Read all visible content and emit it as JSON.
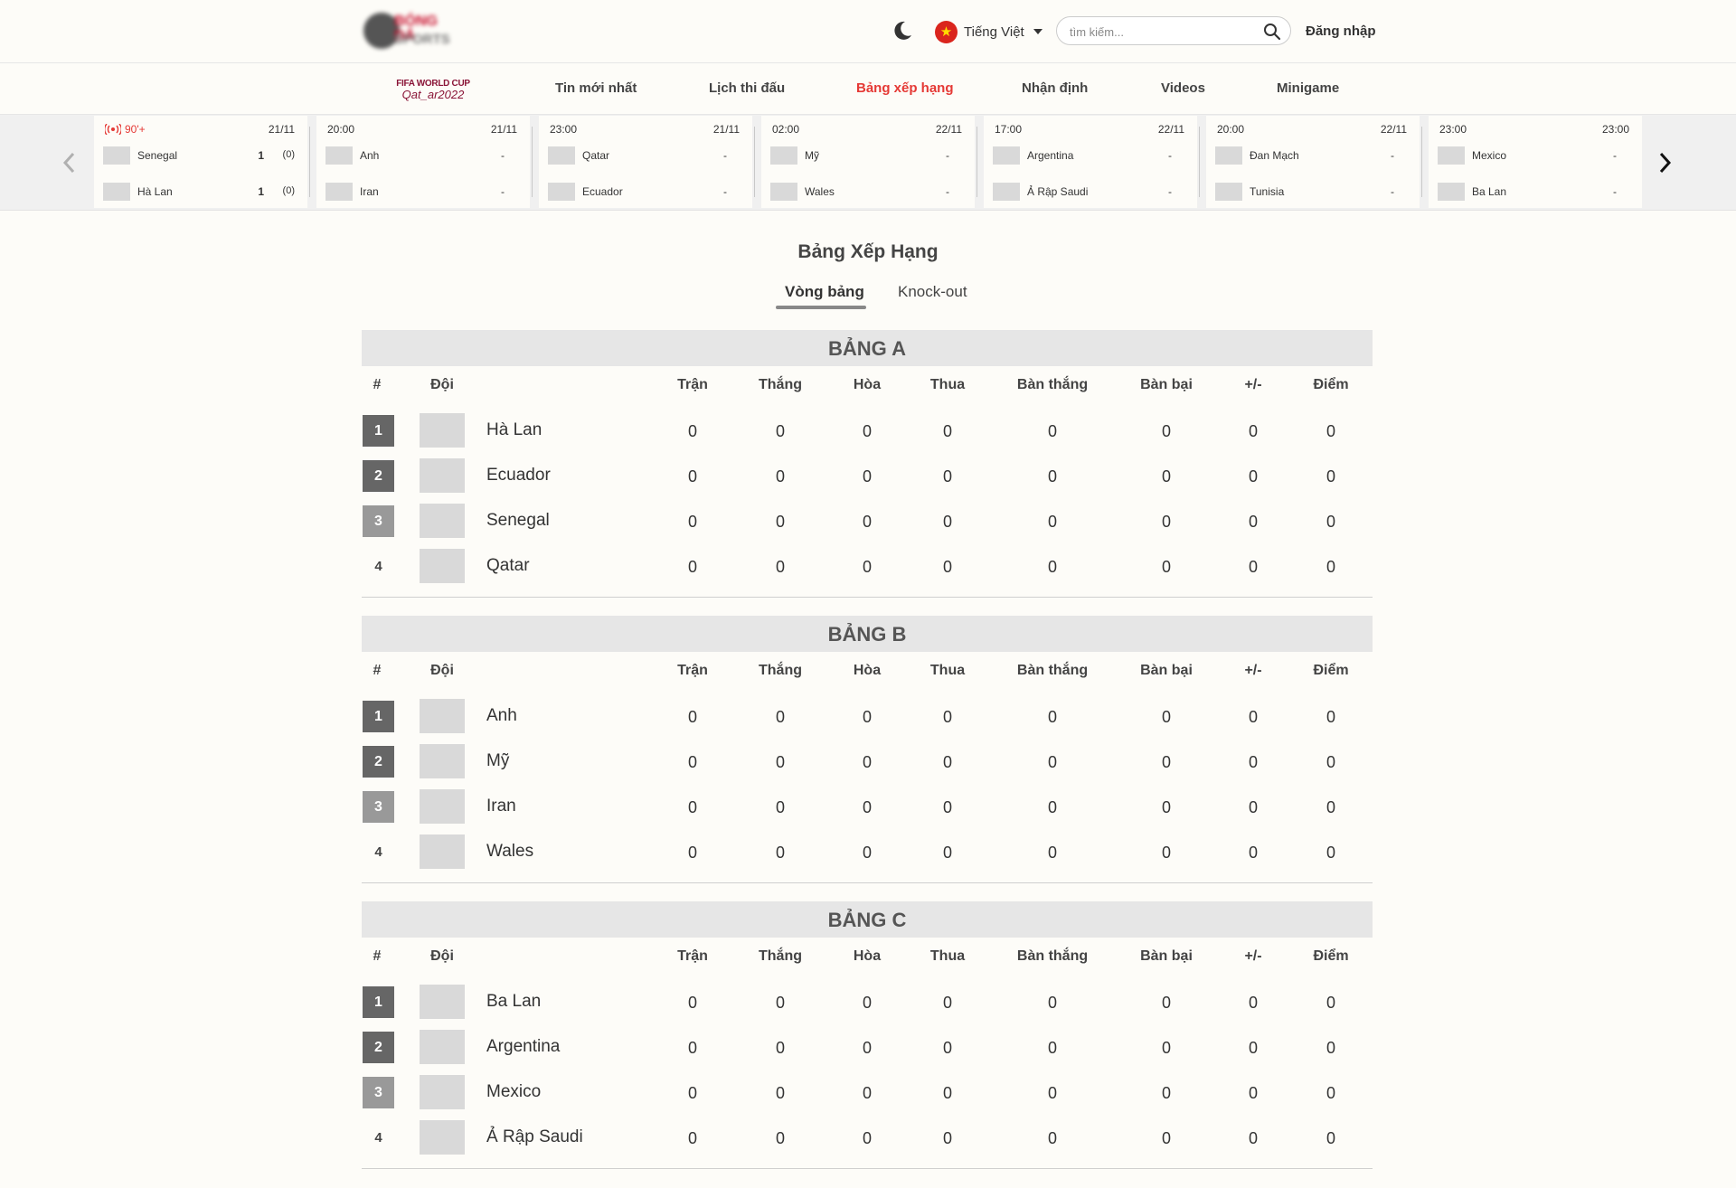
{
  "header": {
    "logo_line1": "BÓNG ĐÁ",
    "logo_line2": "SPORTS",
    "language": "Tiếng Việt",
    "search_placeholder": "tìm kiếm...",
    "login": "Đăng nhập"
  },
  "nav": {
    "wc_logo_line1": "FIFA WORLD CUP",
    "wc_logo_line2": "Qat_ar2022",
    "items": [
      "Tin mới nhất",
      "Lịch thi đấu",
      "Bảng xếp hạng",
      "Nhận định",
      "Videos",
      "Minigame"
    ],
    "active": "Bảng xếp hạng"
  },
  "matches": [
    {
      "time": "90'+",
      "live": true,
      "date": "21/11",
      "home": "Senegal",
      "away": "Hà Lan",
      "home_score": "1",
      "away_score": "1",
      "home_pen": "(0)",
      "away_pen": "(0)"
    },
    {
      "time": "20:00",
      "date": "21/11",
      "home": "Anh",
      "away": "Iran",
      "home_score": "-",
      "away_score": "-"
    },
    {
      "time": "23:00",
      "date": "21/11",
      "home": "Qatar",
      "away": "Ecuador",
      "home_score": "-",
      "away_score": "-"
    },
    {
      "time": "02:00",
      "date": "22/11",
      "home": "Mỹ",
      "away": "Wales",
      "home_score": "-",
      "away_score": "-"
    },
    {
      "time": "17:00",
      "date": "22/11",
      "home": "Argentina",
      "away": "Ả Rập Saudi",
      "home_score": "-",
      "away_score": "-"
    },
    {
      "time": "20:00",
      "date": "22/11",
      "home": "Đan Mạch",
      "away": "Tunisia",
      "home_score": "-",
      "away_score": "-"
    },
    {
      "time": "23:00",
      "date": "23:00",
      "home": "Mexico",
      "away": "Ba Lan",
      "home_score": "-",
      "away_score": "-"
    }
  ],
  "standings": {
    "title": "Bảng Xếp Hạng",
    "tabs": [
      "Vòng bảng",
      "Knock-out"
    ],
    "active_tab": "Vòng bảng",
    "columns": [
      "#",
      "Đội",
      "Trận",
      "Thắng",
      "Hòa",
      "Thua",
      "Bàn thắng",
      "Bàn bại",
      "+/-",
      "Điểm"
    ],
    "groups": [
      {
        "name": "BẢNG A",
        "rows": [
          {
            "rank": "1",
            "team": "Hà Lan",
            "stats": [
              "0",
              "0",
              "0",
              "0",
              "0",
              "0",
              "0",
              "0"
            ]
          },
          {
            "rank": "2",
            "team": "Ecuador",
            "stats": [
              "0",
              "0",
              "0",
              "0",
              "0",
              "0",
              "0",
              "0"
            ]
          },
          {
            "rank": "3",
            "team": "Senegal",
            "stats": [
              "0",
              "0",
              "0",
              "0",
              "0",
              "0",
              "0",
              "0"
            ]
          },
          {
            "rank": "4",
            "team": "Qatar",
            "stats": [
              "0",
              "0",
              "0",
              "0",
              "0",
              "0",
              "0",
              "0"
            ]
          }
        ]
      },
      {
        "name": "BẢNG B",
        "rows": [
          {
            "rank": "1",
            "team": "Anh",
            "stats": [
              "0",
              "0",
              "0",
              "0",
              "0",
              "0",
              "0",
              "0"
            ]
          },
          {
            "rank": "2",
            "team": "Mỹ",
            "stats": [
              "0",
              "0",
              "0",
              "0",
              "0",
              "0",
              "0",
              "0"
            ]
          },
          {
            "rank": "3",
            "team": "Iran",
            "stats": [
              "0",
              "0",
              "0",
              "0",
              "0",
              "0",
              "0",
              "0"
            ]
          },
          {
            "rank": "4",
            "team": "Wales",
            "stats": [
              "0",
              "0",
              "0",
              "0",
              "0",
              "0",
              "0",
              "0"
            ]
          }
        ]
      },
      {
        "name": "BẢNG C",
        "rows": [
          {
            "rank": "1",
            "team": "Ba Lan",
            "stats": [
              "0",
              "0",
              "0",
              "0",
              "0",
              "0",
              "0",
              "0"
            ]
          },
          {
            "rank": "2",
            "team": "Argentina",
            "stats": [
              "0",
              "0",
              "0",
              "0",
              "0",
              "0",
              "0",
              "0"
            ]
          },
          {
            "rank": "3",
            "team": "Mexico",
            "stats": [
              "0",
              "0",
              "0",
              "0",
              "0",
              "0",
              "0",
              "0"
            ]
          },
          {
            "rank": "4",
            "team": "Ả Rập Saudi",
            "stats": [
              "0",
              "0",
              "0",
              "0",
              "0",
              "0",
              "0",
              "0"
            ]
          }
        ]
      }
    ]
  },
  "colors": {
    "accent": "#e53935",
    "live": "#e53935",
    "rank_top": "#666666",
    "rank_third": "#999999"
  }
}
